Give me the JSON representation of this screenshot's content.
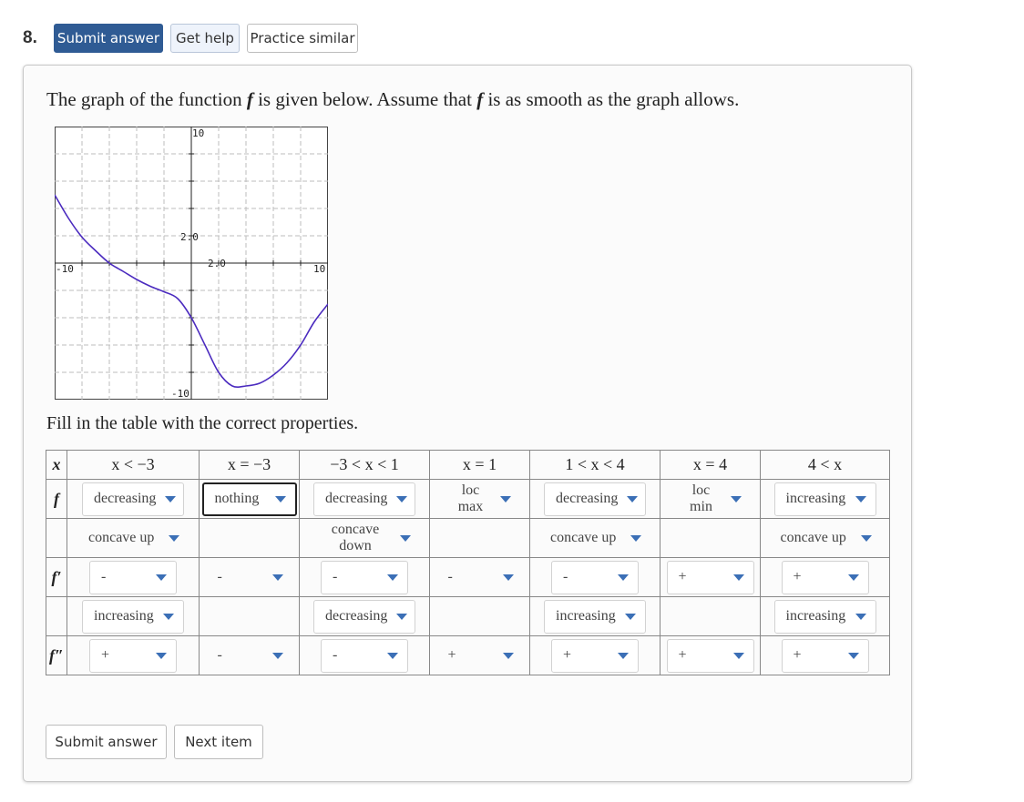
{
  "question": {
    "number": "8."
  },
  "toolbar": {
    "submit": "Submit answer",
    "help": "Get help",
    "practice": "Practice similar"
  },
  "prompt": {
    "before": "The graph of the function ",
    "f": "f",
    "middle": " is given below. Assume that ",
    "after": " is as smooth as the graph allows."
  },
  "graph": {
    "label_top": "10",
    "label_bottom": "-10",
    "label_left": "-10",
    "label_right": "10",
    "label_y_tick": "2.0",
    "label_x_tick": "2.0",
    "curve_color": "#4b2bbf",
    "chart_data": {
      "type": "line",
      "xlim": [
        -10,
        10
      ],
      "ylim": [
        -10,
        10
      ],
      "x": [
        -10,
        -9,
        -8,
        -7,
        -6,
        -5,
        -4,
        -3,
        -2,
        -1,
        0,
        1,
        2,
        3,
        4,
        5,
        6,
        7,
        8,
        9,
        10
      ],
      "y": [
        5,
        3.3,
        1.9,
        0.9,
        0,
        -0.6,
        -1.2,
        -1.7,
        -2.1,
        -2.6,
        -4,
        -6,
        -8,
        -9,
        -9,
        -8.8,
        -8.2,
        -7.3,
        -6,
        -4.3,
        -3
      ]
    }
  },
  "fill_text": "Fill in the table with the correct properties.",
  "table": {
    "headers": [
      "x < −3",
      "x = −3",
      "−3 < x < 1",
      "x = 1",
      "1 < x < 4",
      "x = 4",
      "4 < x"
    ],
    "row_labels": {
      "x": "x",
      "f": "f",
      "fp": "f′",
      "fpp": "f″"
    },
    "f_mono": [
      "decreasing",
      "nothing",
      "decreasing",
      "loc max",
      "decreasing",
      "loc min",
      "increasing"
    ],
    "f_conc": [
      "concave up",
      "",
      "concave down",
      "",
      "concave up",
      "",
      "concave up"
    ],
    "fp_sign": [
      "-",
      "-",
      "-",
      "-",
      "-",
      "+",
      "+"
    ],
    "fp_mono": [
      "increasing",
      "",
      "decreasing",
      "",
      "increasing",
      "",
      "increasing"
    ],
    "fpp_sign": [
      "+",
      "-",
      "-",
      "+",
      "+",
      "+",
      "+"
    ]
  },
  "bottom": {
    "submit": "Submit answer",
    "next": "Next item"
  }
}
